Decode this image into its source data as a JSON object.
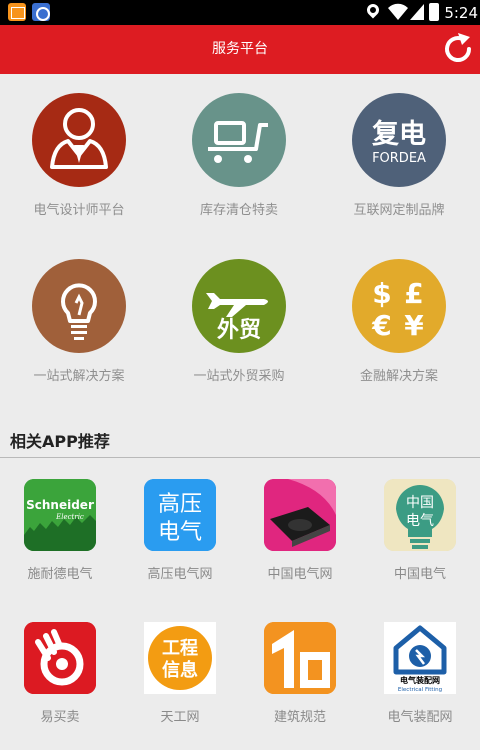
{
  "status_bar": {
    "time": "5:24",
    "icons": [
      "app-notification-icon",
      "app-notification-icon",
      "location-icon",
      "wifi-icon",
      "signal-icon",
      "battery-icon"
    ]
  },
  "header": {
    "title": "服务平台",
    "refresh_icon": "refresh-icon"
  },
  "services": [
    {
      "label": "电气设计师平台",
      "icon": "engineer-icon",
      "color": "#a62a14"
    },
    {
      "label": "库存清仓特卖",
      "icon": "cart-icon",
      "color": "#68938a"
    },
    {
      "label": "互联网定制品牌",
      "icon": "fordea-logo",
      "color": "#4f6179",
      "logo_cn": "复电",
      "logo_en": "FORDEA"
    },
    {
      "label": "一站式解决方案",
      "icon": "lightbulb-icon",
      "color": "#a0603a"
    },
    {
      "label": "一站式外贸采购",
      "icon": "airplane-icon",
      "color": "#6c901f",
      "logo_cn": "外贸"
    },
    {
      "label": "金融解决方案",
      "icon": "currency-icon",
      "color": "#e2aa2b",
      "symbols": "$£€¥"
    }
  ],
  "apps_section": {
    "title": "相关APP推荐"
  },
  "apps": [
    {
      "label": "施耐德电气",
      "icon": "schneider-electric-logo",
      "logo_text": "Schneider",
      "logo_sub": "Electric"
    },
    {
      "label": "高压电气网",
      "icon": "gaoya-logo",
      "logo_text": "高压电气"
    },
    {
      "label": "中国电气网",
      "icon": "induction-cooker-icon"
    },
    {
      "label": "中国电气",
      "icon": "zhongguo-dianqi-logo",
      "logo_text": "中国电气"
    },
    {
      "label": "易买卖",
      "icon": "yimaimai-logo"
    },
    {
      "label": "天工网",
      "icon": "tiangong-logo",
      "logo_text": "工程信息"
    },
    {
      "label": "建筑规范",
      "icon": "building-standard-logo"
    },
    {
      "label": "电气装配网",
      "icon": "electrical-fitting-logo",
      "logo_text": "电气装配网",
      "logo_sub": "Electrical Fitting"
    }
  ]
}
